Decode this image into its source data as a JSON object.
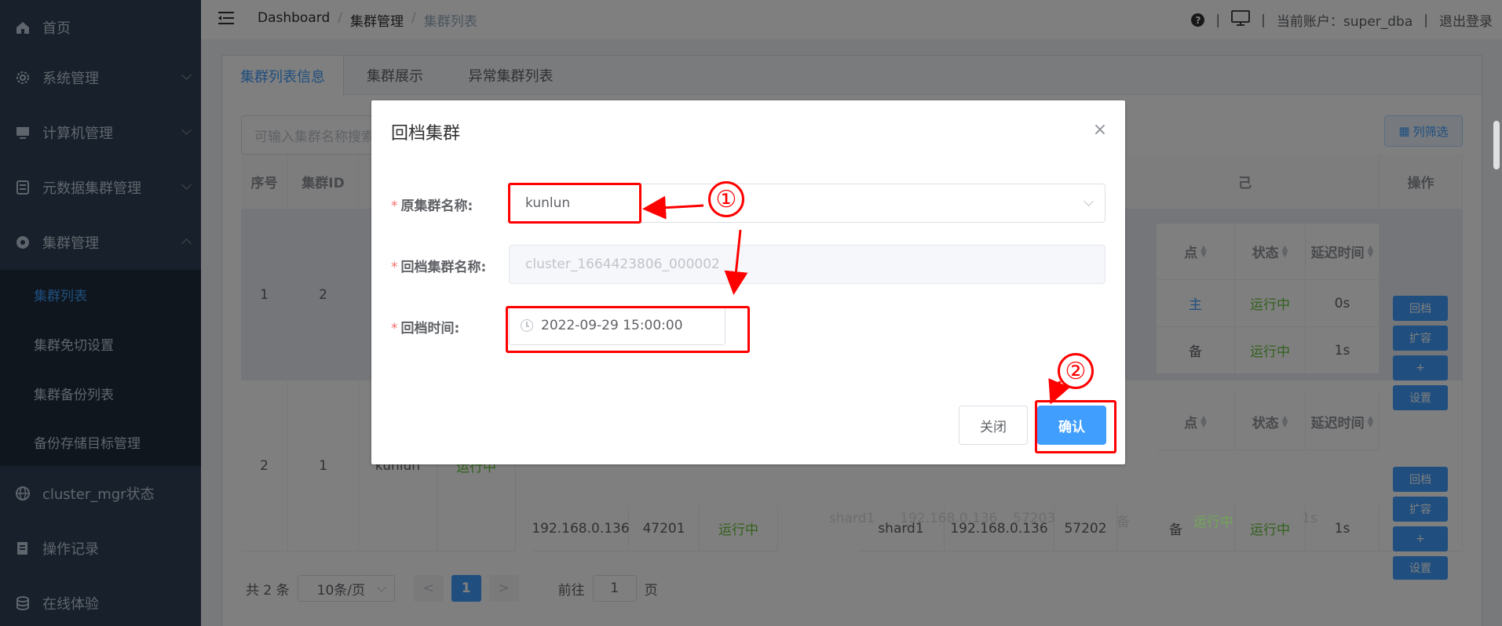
{
  "sidebar": {
    "items": [
      {
        "label": "首页",
        "icon": "home-icon"
      },
      {
        "label": "系统管理",
        "icon": "gear-icon"
      },
      {
        "label": "计算机管理",
        "icon": "monitor-icon"
      },
      {
        "label": "元数据集群管理",
        "icon": "database-icon"
      },
      {
        "label": "集群管理",
        "icon": "cluster-icon"
      },
      {
        "label": "cluster_mgr状态",
        "icon": "status-icon"
      },
      {
        "label": "操作记录",
        "icon": "log-icon"
      },
      {
        "label": "在线体验",
        "icon": "stack-icon"
      }
    ],
    "subitems": [
      "集群列表",
      "集群免切设置",
      "集群备份列表",
      "备份存储目标管理"
    ]
  },
  "header": {
    "breadcrumb": [
      "Dashboard",
      "集群管理",
      "集群列表"
    ],
    "account_label": "当前账户：super_dba",
    "logout": "退出登录",
    "help": "?",
    "divider": "|"
  },
  "tabs": [
    "集群列表信息",
    "集群展示",
    "异常集群列表"
  ],
  "search": {
    "placeholder": "可输入集群名称搜索"
  },
  "col_filter_label": "列筛选",
  "table": {
    "headers": {
      "index": "序号",
      "cluster_id": "集群ID",
      "operation": "操作",
      "point": "点",
      "status": "状态",
      "delay": "延迟时间",
      "group_title": "己"
    },
    "rows": [
      {
        "index": "1",
        "cluster_id": "2"
      },
      {
        "index": "2",
        "cluster_id": "1",
        "name": "kunlun",
        "status": "运行中"
      }
    ],
    "row1_right": [
      {
        "point": "主",
        "status": "运行中",
        "delay": "0s"
      },
      {
        "point": "备",
        "status": "运行中",
        "delay": "1s"
      }
    ],
    "row2_mid": {
      "ip": "192.168.0.136",
      "port": "47201",
      "status": "运行中"
    },
    "row2_right": [
      {
        "shard": "shard1",
        "ip": "192.168.0.136",
        "port": "57202",
        "role": "备",
        "status": "运行中",
        "delay": "1s"
      },
      {
        "shard": "shard1",
        "ip": "192.168.0.136",
        "port": "57203",
        "role": "备",
        "status": "运行中",
        "delay": "1s"
      }
    ],
    "ops": [
      "回档",
      "扩容",
      "+",
      "设置"
    ]
  },
  "pagination": {
    "total": "共 2 条",
    "per_page": "10条/页",
    "prev": "<",
    "current": "1",
    "next": ">",
    "goto": "前往",
    "goto_value": "1",
    "page_suffix": "页"
  },
  "dialog": {
    "title": "回档集群",
    "close": "×",
    "fields": {
      "src_label": "原集群名称:",
      "src_value": "kunlun",
      "dst_label": "回档集群名称:",
      "dst_placeholder": "cluster_1664423806_000002",
      "time_label": "回档时间:",
      "time_value": "2022-09-29 15:00:00",
      "required_mark": "*"
    },
    "buttons": {
      "close": "关闭",
      "confirm": "确认"
    }
  },
  "annotations": {
    "step1": "①",
    "step2": "②",
    "color": "#ff0000"
  },
  "colors": {
    "primary": "#409eff",
    "success": "#67c23a",
    "sidebar": "#304156"
  }
}
